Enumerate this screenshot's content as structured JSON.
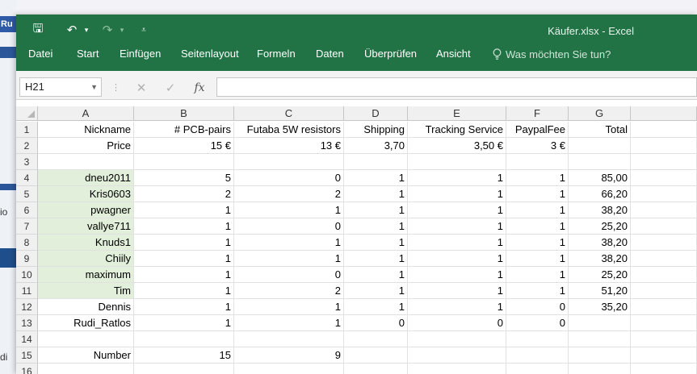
{
  "background": {
    "tab_label": "Ru",
    "fragment_1": "io",
    "fragment_2": "di"
  },
  "window": {
    "title": "Käufer.xlsx - Excel",
    "quick_access": {
      "save": "🖫",
      "undo": "↶",
      "redo": "↷",
      "dropdown": "▾",
      "customize": "⩡"
    },
    "menu": [
      {
        "label": "Datei"
      },
      {
        "label": "Start"
      },
      {
        "label": "Einfügen"
      },
      {
        "label": "Seitenlayout"
      },
      {
        "label": "Formeln"
      },
      {
        "label": "Daten"
      },
      {
        "label": "Überprüfen"
      },
      {
        "label": "Ansicht"
      }
    ],
    "tell_me": "Was möchten Sie tun?",
    "accent": "#217346"
  },
  "formula_bar": {
    "name_box": "H21",
    "cancel": "✕",
    "confirm": "✓",
    "fx": "fx",
    "value": ""
  },
  "sheet": {
    "columns": [
      "A",
      "B",
      "C",
      "D",
      "E",
      "F",
      "G"
    ],
    "rows": [
      {
        "n": "1",
        "cells": [
          "Nickname",
          "# PCB-pairs",
          "Futaba 5W resistors",
          "Shipping",
          "Tracking Service",
          "PaypalFee",
          "Total"
        ]
      },
      {
        "n": "2",
        "cells": [
          "Price",
          "15 €",
          "13 €",
          "3,70",
          "3,50 €",
          "3 €",
          ""
        ]
      },
      {
        "n": "3",
        "cells": [
          "",
          "",
          "",
          "",
          "",
          "",
          ""
        ]
      },
      {
        "n": "4",
        "cells": [
          "dneu2011",
          "5",
          "0",
          "1",
          "1",
          "1",
          "85,00"
        ]
      },
      {
        "n": "5",
        "cells": [
          "Kris0603",
          "2",
          "2",
          "1",
          "1",
          "1",
          "66,20"
        ]
      },
      {
        "n": "6",
        "cells": [
          "pwagner",
          "1",
          "1",
          "1",
          "1",
          "1",
          "38,20"
        ]
      },
      {
        "n": "7",
        "cells": [
          "vallye711",
          "1",
          "0",
          "1",
          "1",
          "1",
          "25,20"
        ]
      },
      {
        "n": "8",
        "cells": [
          "Knuds1",
          "1",
          "1",
          "1",
          "1",
          "1",
          "38,20"
        ]
      },
      {
        "n": "9",
        "cells": [
          "Chiily",
          "1",
          "1",
          "1",
          "1",
          "1",
          "38,20"
        ]
      },
      {
        "n": "10",
        "cells": [
          "maximum",
          "1",
          "0",
          "1",
          "1",
          "1",
          "25,20"
        ]
      },
      {
        "n": "11",
        "cells": [
          "Tim",
          "1",
          "2",
          "1",
          "1",
          "1",
          "51,20"
        ]
      },
      {
        "n": "12",
        "cells": [
          "Dennis",
          "1",
          "1",
          "1",
          "1",
          "0",
          "35,20"
        ]
      },
      {
        "n": "13",
        "cells": [
          "Rudi_Ratlos",
          "1",
          "1",
          "0",
          "0",
          "0",
          ""
        ]
      },
      {
        "n": "14",
        "cells": [
          "",
          "",
          "",
          "",
          "",
          "",
          ""
        ]
      },
      {
        "n": "15",
        "cells": [
          "Number",
          "15",
          "9",
          "",
          "",
          "",
          ""
        ]
      },
      {
        "n": "16",
        "cells": [
          "",
          "",
          "",
          "",
          "",
          "",
          ""
        ]
      }
    ],
    "highlight_rows": [
      "4",
      "5",
      "6",
      "7",
      "8",
      "9",
      "10",
      "11"
    ],
    "highlight_color": "#e2efda"
  }
}
